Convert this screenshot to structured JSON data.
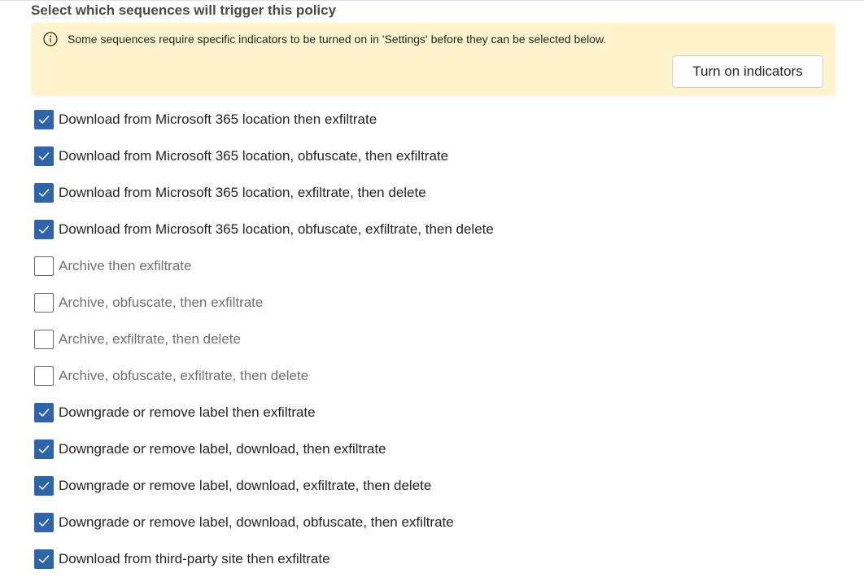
{
  "section": {
    "title": "Select which sequences will trigger this policy"
  },
  "banner": {
    "icon": "info-icon",
    "message": "Some sequences require specific indicators to be turned on in 'Settings' before they can be selected below.",
    "button_label": "Turn on indicators",
    "background_color": "#fff4ce"
  },
  "colors": {
    "checkbox_checked": "#2f64a8",
    "checkbox_unchecked_border": "#6b6b6b",
    "text_disabled": "#707070"
  },
  "sequences": [
    {
      "label": "Download from Microsoft 365 location then exfiltrate",
      "checked": true,
      "enabled": true
    },
    {
      "label": "Download from Microsoft 365 location, obfuscate, then exfiltrate",
      "checked": true,
      "enabled": true
    },
    {
      "label": "Download from Microsoft 365 location, exfiltrate, then delete",
      "checked": true,
      "enabled": true
    },
    {
      "label": "Download from Microsoft 365 location, obfuscate, exfiltrate, then delete",
      "checked": true,
      "enabled": true
    },
    {
      "label": "Archive then exfiltrate",
      "checked": false,
      "enabled": false
    },
    {
      "label": "Archive, obfuscate, then exfiltrate",
      "checked": false,
      "enabled": false
    },
    {
      "label": "Archive, exfiltrate, then delete",
      "checked": false,
      "enabled": false
    },
    {
      "label": "Archive, obfuscate, exfiltrate, then delete",
      "checked": false,
      "enabled": false
    },
    {
      "label": "Downgrade or remove label then exfiltrate",
      "checked": true,
      "enabled": true
    },
    {
      "label": "Downgrade or remove label, download, then exfiltrate",
      "checked": true,
      "enabled": true
    },
    {
      "label": "Downgrade or remove label, download, exfiltrate, then delete",
      "checked": true,
      "enabled": true
    },
    {
      "label": "Downgrade or remove label, download, obfuscate, then exfiltrate",
      "checked": true,
      "enabled": true
    },
    {
      "label": "Download from third-party site then exfiltrate",
      "checked": true,
      "enabled": true
    }
  ]
}
